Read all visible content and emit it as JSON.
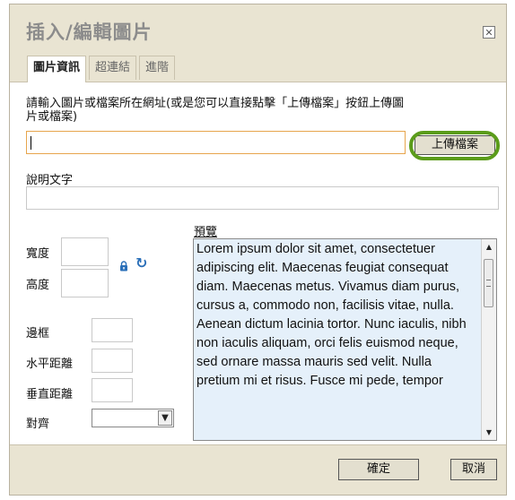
{
  "dialog": {
    "title": "插入/編輯圖片",
    "close_icon": "close-icon"
  },
  "tabs": [
    {
      "label": "圖片資訊",
      "active": true
    },
    {
      "label": "超連結",
      "active": false
    },
    {
      "label": "進階",
      "active": false
    }
  ],
  "form": {
    "url_label": "請輸入圖片或檔案所在網址(或是您可以直接點擊「上傳檔案」按鈕上傳圖片或檔案)",
    "url_value": "",
    "upload_label": "上傳檔案",
    "caption_label": "說明文字",
    "caption_value": "",
    "width_label": "寬度",
    "height_label": "高度",
    "width_value": "",
    "height_value": "",
    "border_label": "邊框",
    "hspace_label": "水平距離",
    "vspace_label": "垂直距離",
    "align_label": "對齊",
    "align_value": ""
  },
  "preview": {
    "label": "預覽",
    "text": "Lorem ipsum dolor sit amet, consectetuer adipiscing elit. Maecenas feugiat consequat diam. Maecenas metus. Vivamus diam purus, cursus a, commodo non, facilisis vitae, nulla. Aenean dictum lacinia tortor. Nunc iaculis, nibh non iaculis aliquam, orci felis euismod neque, sed ornare massa mauris sed velit. Nulla pretium mi et risus. Fusce mi pede, tempor"
  },
  "footer": {
    "ok_label": "確定",
    "cancel_label": "取消"
  },
  "colors": {
    "highlight": "#5b9c1a",
    "header_bg": "#e9e4d2",
    "preview_bg": "#e5f0fa",
    "reset_icon": "#2a6fb8"
  }
}
